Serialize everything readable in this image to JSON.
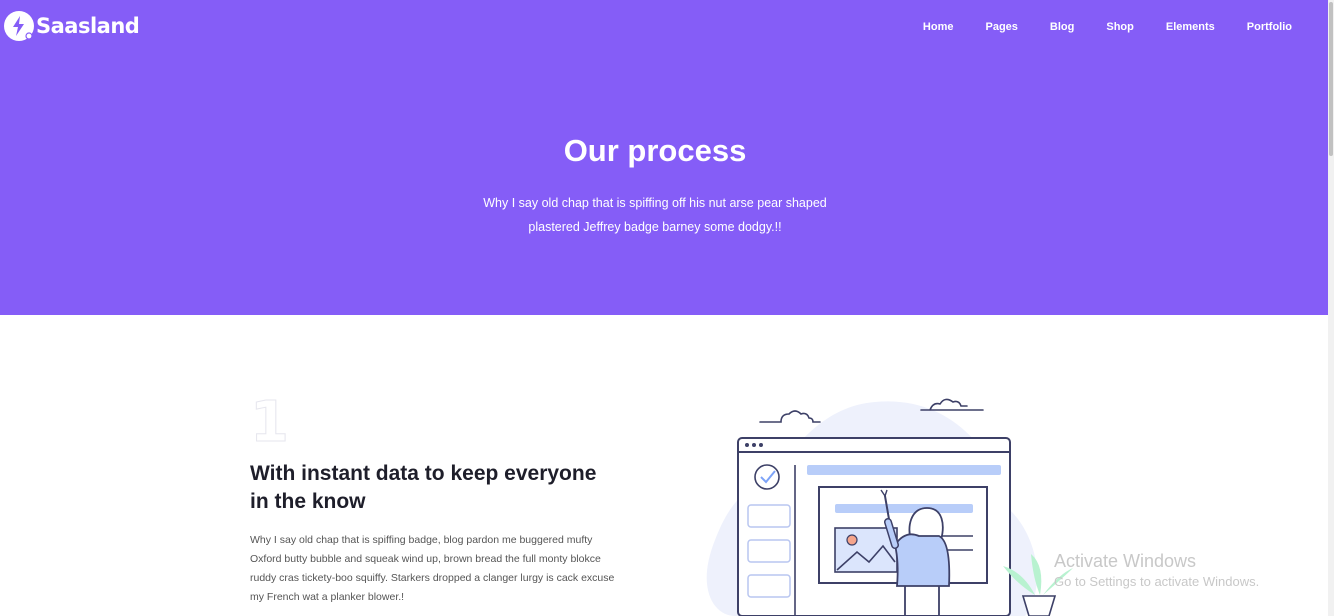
{
  "brand": {
    "name": "Saasland",
    "logo_icon": "lightning-bolt-icon"
  },
  "nav": {
    "items": [
      "Home",
      "Pages",
      "Blog",
      "Shop",
      "Elements",
      "Portfolio"
    ]
  },
  "hero": {
    "title": "Our process",
    "subtitle": "Why I say old chap that is spiffing off his nut arse pear shaped plastered Jeffrey badge barney some dodgy.!!",
    "background": "#855df7"
  },
  "step": {
    "number": "1",
    "title": "With instant data to keep everyone in the know",
    "text": "Why I say old chap that is spiffing badge, blog pardon me buggered mufty Oxford butty bubble and squeak wind up, brown bread the full monty blokce ruddy cras tickety-boo squiffy. Starkers dropped a clanger lurgy is cack excuse my French wat a planker blower.!"
  },
  "os_overlay": {
    "title": "Activate Windows",
    "subtitle": "Go to Settings to activate Windows."
  }
}
